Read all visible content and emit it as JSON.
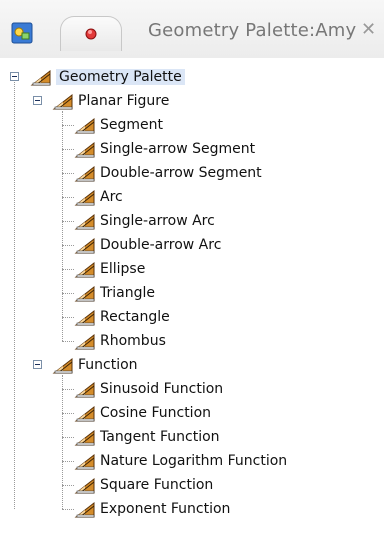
{
  "window": {
    "title": "Geometry Palette:Amy",
    "tabs": [
      {
        "icon": "toolbox-icon"
      },
      {
        "icon": "red-marker-icon"
      }
    ]
  },
  "tree": {
    "root": {
      "label": "Geometry Palette",
      "children": [
        {
          "label": "Planar Figure",
          "children": [
            "Segment",
            "Single-arrow Segment",
            "Double-arrow Segment",
            "Arc",
            "Single-arrow Arc",
            "Double-arrow Arc",
            "Ellipse",
            "Triangle",
            "Rectangle",
            "Rhombus"
          ]
        },
        {
          "label": "Function",
          "children": [
            "Sinusoid Function",
            "Cosine Function",
            "Tangent Function",
            "Nature Logarithm Function",
            "Square Function",
            "Exponent Function"
          ]
        }
      ]
    }
  }
}
